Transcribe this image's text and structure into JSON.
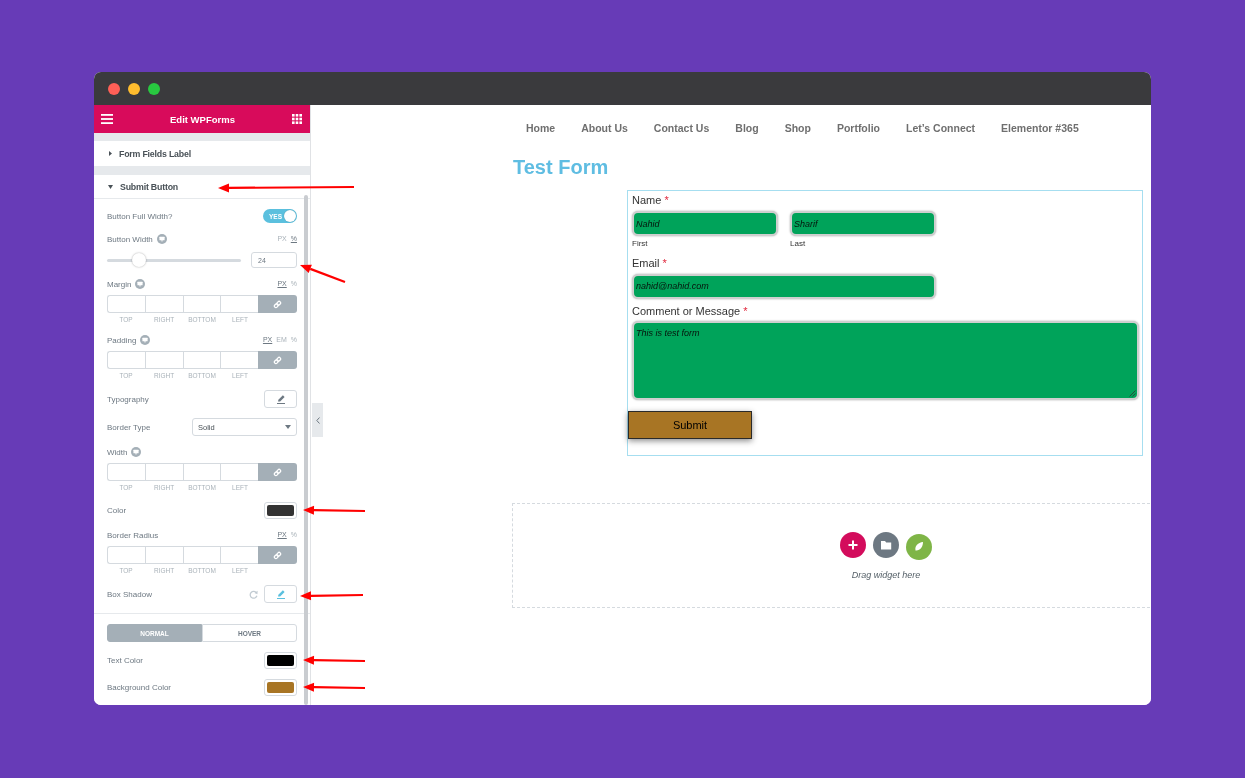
{
  "panel": {
    "title": "Edit WPForms",
    "sections": [
      {
        "label": "Form Fields Label",
        "expanded": false,
        "annotated": false
      },
      {
        "label": "Submit Button",
        "expanded": true,
        "annotated": true
      }
    ],
    "controls": [
      {
        "kind": "switch",
        "label": "Button Full Width?",
        "responsive": false,
        "on": true,
        "switch_text": "YES",
        "annotated": false
      },
      {
        "kind": "slider",
        "label": "Button Width",
        "responsive": true,
        "units": [
          {
            "label": "PX",
            "selected": false
          },
          {
            "label": "%",
            "selected": true
          }
        ],
        "level": 0.24,
        "value": "24",
        "annotated": true
      },
      {
        "kind": "dimensions",
        "label": "Margin",
        "responsive": true,
        "units": [
          {
            "label": "PX",
            "selected": true
          },
          {
            "label": "%",
            "selected": false
          }
        ],
        "sides": [
          "TOP",
          "RIGHT",
          "BOTTOM",
          "LEFT"
        ],
        "annotated": false
      },
      {
        "kind": "dimensions",
        "label": "Padding",
        "responsive": true,
        "units": [
          {
            "label": "PX",
            "selected": true
          },
          {
            "label": "EM",
            "selected": false
          },
          {
            "label": "%",
            "selected": false
          }
        ],
        "sides": [
          "TOP",
          "RIGHT",
          "BOTTOM",
          "LEFT"
        ],
        "annotated": false
      },
      {
        "kind": "popover",
        "label": "Typography",
        "responsive": false,
        "modified": false,
        "annotated": false
      },
      {
        "kind": "select",
        "label": "Border Type",
        "responsive": false,
        "value": "Solid",
        "annotated": false
      },
      {
        "kind": "dimensions",
        "label": "Width",
        "responsive": true,
        "sides": [
          "TOP",
          "RIGHT",
          "BOTTOM",
          "LEFT"
        ],
        "annotated": false
      },
      {
        "kind": "color",
        "label": "Color",
        "responsive": false,
        "color": "#333333",
        "annotated": true
      },
      {
        "kind": "dimensions",
        "label": "Border Radius",
        "responsive": false,
        "units": [
          {
            "label": "PX",
            "selected": true
          },
          {
            "label": "%",
            "selected": false
          }
        ],
        "sides": [
          "TOP",
          "RIGHT",
          "BOTTOM",
          "LEFT"
        ],
        "annotated": false
      },
      {
        "kind": "popover",
        "label": "Box Shadow",
        "responsive": false,
        "modified": true,
        "annotated": true
      }
    ],
    "state_tabs": [
      {
        "label": "NORMAL",
        "selected": true
      },
      {
        "label": "HOVER",
        "selected": false
      }
    ],
    "tab_controls": [
      {
        "kind": "color",
        "label": "Text Color",
        "responsive": false,
        "color": "#000000",
        "annotated": true
      },
      {
        "kind": "color",
        "label": "Background Color",
        "responsive": false,
        "color": "#a87524",
        "annotated": true
      }
    ]
  },
  "preview": {
    "nav": [
      "Home",
      "About Us",
      "Contact Us",
      "Blog",
      "Shop",
      "Portfolio",
      "Let’s Connect",
      "Elementor #365"
    ],
    "heading": "Test Form",
    "form": {
      "fields": [
        {
          "kind": "name",
          "label": "Name",
          "required_mark": "*",
          "parts": [
            {
              "value": "Nahid",
              "sublabel": "First"
            },
            {
              "value": "Sharif",
              "sublabel": "Last"
            }
          ]
        },
        {
          "kind": "email",
          "label": "Email",
          "required_mark": "*",
          "value": "nahid@nahid.com"
        },
        {
          "kind": "textarea",
          "label": "Comment or Message",
          "required_mark": "*",
          "value": "This is test form"
        }
      ],
      "submit": "Submit"
    },
    "drop_zone": {
      "hint": "Drag widget here"
    }
  }
}
